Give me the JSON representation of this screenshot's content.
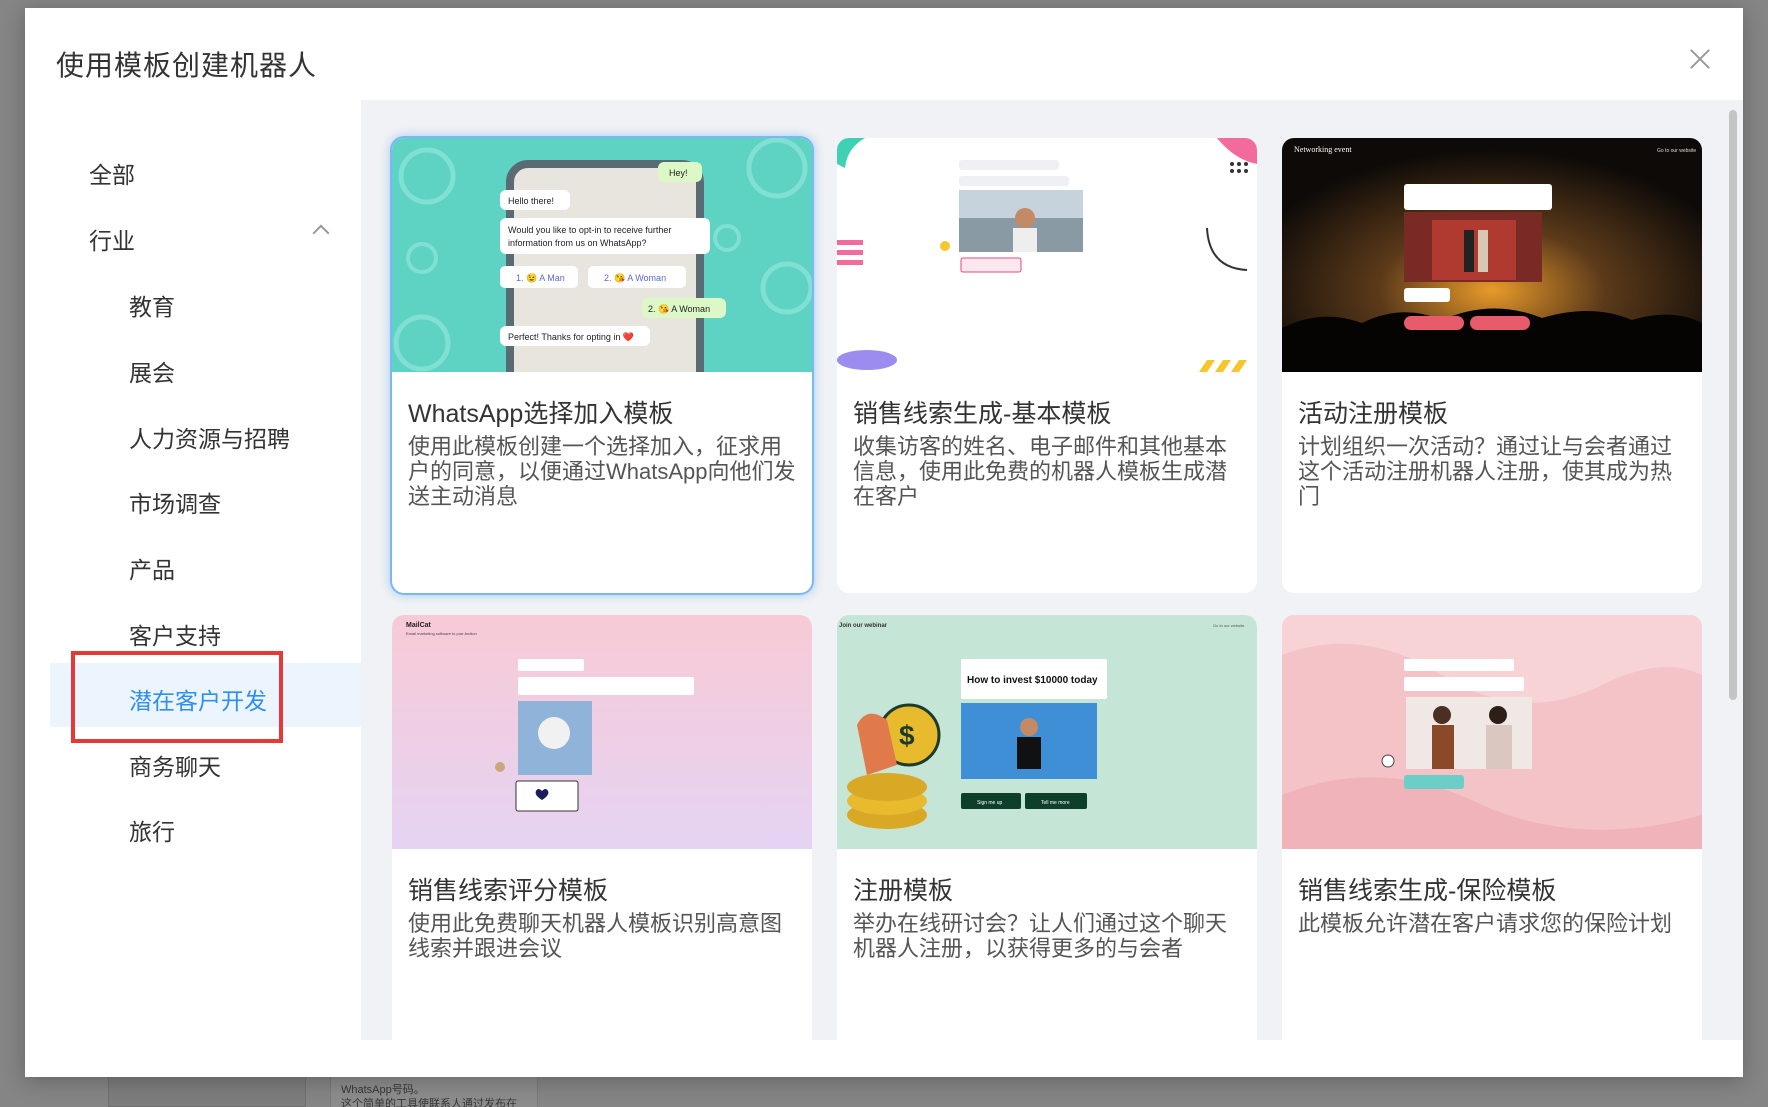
{
  "backdrop": {
    "card_text": "WhatsApp号码。\n这个简单的工具使联系人通过发布在"
  },
  "modal": {
    "title": "使用模板创建机器人",
    "close_icon": "close-icon"
  },
  "sidebar": {
    "all": "全部",
    "industry": "行业",
    "items": [
      "教育",
      "展会",
      "人力资源与招聘",
      "市场调查",
      "产品",
      "客户支持",
      "潜在客户开发",
      "商务聊天",
      "旅行"
    ],
    "active_index": 6
  },
  "cards": [
    {
      "title": "WhatsApp选择加入模板",
      "desc": "使用此模板创建一个选择加入，征求用户的同意，以便通过WhatsApp向他们发送主动消息",
      "img": {
        "hey": "Hey!",
        "hello": "Hello there!",
        "q1": "Would you like to opt-in to receive further",
        "q2": "information from us on WhatsApp?",
        "o1": "1. 😉 A Man",
        "o2": "2. 😘 A Woman",
        "a": "2. 😘 A Woman",
        "thanks": "Perfect! Thanks for opting in ❤️"
      }
    },
    {
      "title": "销售线索生成-基本模板",
      "desc": "收集访客的姓名、电子邮件和其他基本信息，使用此免费的机器人模板生成潜在客户",
      "img": {}
    },
    {
      "title": "活动注册模板",
      "desc": "计划组织一次活动？通过让与会者通过这个活动注册机器人注册，使其成为热门",
      "img": {
        "brand": "Networking event",
        "corner": "Go to our website"
      }
    },
    {
      "title": "销售线索评分模板",
      "desc": "使用此免费聊天机器人模板识别高意图线索并跟进会议",
      "img": {
        "brand": "MailCat",
        "sub": "Email marketing software to purr-fection"
      }
    },
    {
      "title": "注册模板",
      "desc": "举办在线研讨会？让人们通过这个聊天机器人注册，以获得更多的与会者",
      "img": {
        "head": "Join our webinar",
        "corner": "Go to our website",
        "how": "How to invest $10000 today",
        "btn1": "Sign me up",
        "btn2": "Tell me more"
      }
    },
    {
      "title": "销售线索生成-保险模板",
      "desc": "此模板允许潜在客户请求您的保险计划",
      "img": {}
    }
  ]
}
